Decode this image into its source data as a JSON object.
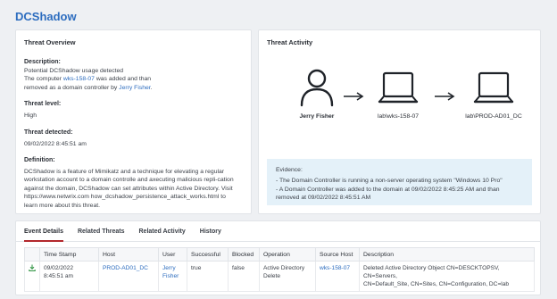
{
  "page": {
    "title": "DCShadow"
  },
  "overview": {
    "heading": "Threat Overview",
    "description_label": "Description:",
    "description_line1": "Potential DCShadow usage detected",
    "desc_pre": "The computer ",
    "desc_computer": "wks-158-07",
    "desc_mid1": " was added and than",
    "desc_mid2": "removed as a domain controller by ",
    "desc_user": "Jerry Fisher",
    "desc_end": ".",
    "threat_level_label": "Threat level:",
    "threat_level": "High",
    "threat_detected_label": "Threat detected:",
    "threat_detected": "09/02/2022 8:45:51 am",
    "definition_label": "Definition:",
    "definition_lines": [
      "DCShadow is a feature of Mimikatz and a technique for elevating a regular",
      "workstation account to a domain controlle and axecuting malicious repli-cation",
      "against the domain, DCShadow can set attributes within Active Directory. Visit",
      "https://www.netwrix.com how_dcshadow_persistence_attack_works.html to",
      "learn more about this threat."
    ]
  },
  "activity": {
    "heading": "Threat Activity",
    "nodes": [
      {
        "label": "Jerry Fisher",
        "icon": "user-icon"
      },
      {
        "label": "lab\\wks-158-07",
        "icon": "laptop-icon"
      },
      {
        "label": "lab\\PROD-AD01_DC",
        "icon": "laptop-icon"
      }
    ],
    "evidence_label": "Evidence:",
    "evidence_lines": [
      "- The Domain Controller is running a non-server operating system \"Windows 10 Pro\"",
      "- A Domain Controller was added to the domain at 09/02/2022 8:45:25 AM and than",
      "removed at 09/02/2022 8:45:51 AM"
    ]
  },
  "details": {
    "tabs": [
      "Event Details",
      "Related Threats",
      "Related Activity",
      "History"
    ],
    "active_tab": "Event Details",
    "columns": [
      "",
      "Time Stamp",
      "Host",
      "User",
      "Successful",
      "Blocked",
      "Operation",
      "Source Host",
      "Description"
    ],
    "row": {
      "icon": "download-icon",
      "time_line1": "09/02/2022",
      "time_line2": "8:45:51 am",
      "host": "PROD-AD01_DC",
      "user_line1": "Jerry",
      "user_line2": "Fisher",
      "successful": "true",
      "blocked": "false",
      "operation_line1": "Active Directory",
      "operation_line2": "Delete",
      "source_host": "wks-158-07",
      "description_line1": "Deleted Active Directory Object CN=DESCKTOPSV, CN=Servers,",
      "description_line2": "CN=Default_Site, CN=Sites, CN=Configuration, DC=lab"
    }
  },
  "colors": {
    "accent": "#2d6dbf",
    "active_tab_underline": "#b3282d",
    "evidence_bg": "#e4f1f9",
    "icon_green": "#3c9a4e"
  }
}
